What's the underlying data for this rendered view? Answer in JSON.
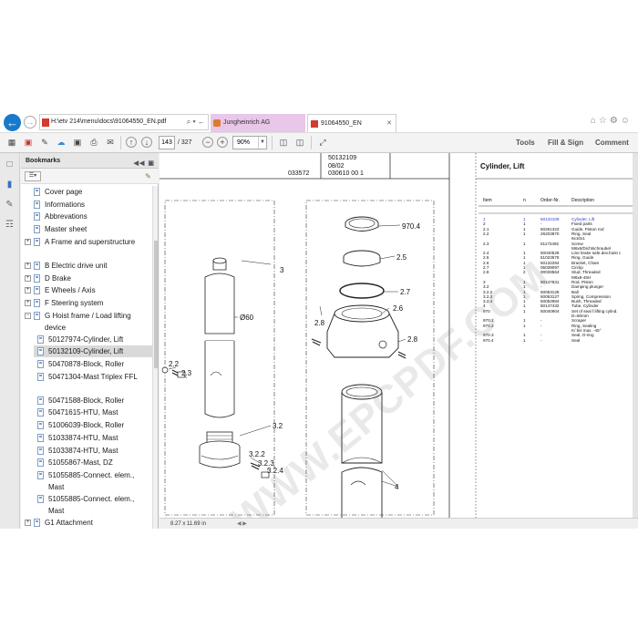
{
  "browser": {
    "url": "H:\\etv 214\\menu\\docs\\91064550_EN.pdf",
    "url_icons": "⌕ ▾ ←",
    "tabs": [
      {
        "label": "Jungheinrich AG"
      },
      {
        "label": "91064550_EN"
      }
    ]
  },
  "toolbar": {
    "current_page": "143",
    "page_total": "/ 327",
    "zoom": "90%",
    "links": {
      "tools": "Tools",
      "fill_sign": "Fill & Sign",
      "comment": "Comment"
    }
  },
  "bookmarks": {
    "title": "Bookmarks",
    "items": [
      {
        "label": "Cover page",
        "level": 1,
        "expandable": false
      },
      {
        "label": "Informations",
        "level": 1,
        "expandable": false
      },
      {
        "label": "Abbrevations",
        "level": 1,
        "expandable": false
      },
      {
        "label": "Master sheet",
        "level": 1,
        "expandable": false
      },
      {
        "label": "A Frame and superstructure",
        "level": 1,
        "expandable": true,
        "expanded": false
      },
      {
        "label": "B Electric drive unit",
        "level": 1,
        "expandable": true,
        "expanded": false
      },
      {
        "label": "D Brake",
        "level": 1,
        "expandable": true,
        "expanded": false
      },
      {
        "label": "E Wheels / Axis",
        "level": 1,
        "expandable": true,
        "expanded": false
      },
      {
        "label": "F Steering system",
        "level": 1,
        "expandable": true,
        "expanded": false
      },
      {
        "label": "G Hoist frame / Load lifting device",
        "level": 1,
        "expandable": true,
        "expanded": true
      },
      {
        "label": "50127974-Cylinder, Lift",
        "level": 2
      },
      {
        "label": "50132109-Cylinder, Lift",
        "level": 2,
        "selected": true
      },
      {
        "label": "50470878-Block, Roller",
        "level": 2
      },
      {
        "label": "50471304-Mast Triplex FFL",
        "level": 2
      },
      {
        "label": "50471588-Block, Roller",
        "level": 2
      },
      {
        "label": "50471615-HTU, Mast",
        "level": 2
      },
      {
        "label": "51006039-Block, Roller",
        "level": 2
      },
      {
        "label": "51033874-HTU, Mast",
        "level": 2
      },
      {
        "label": "51033874-HTU, Mast",
        "level": 2
      },
      {
        "label": "51055867-Mast, DZ",
        "level": 2
      },
      {
        "label": "51055885-Connect. elem., Mast",
        "level": 2
      },
      {
        "label": "51055885-Connect. elem., Mast",
        "level": 2
      },
      {
        "label": "G1 Attachment",
        "level": 1,
        "expandable": true,
        "expanded": false
      },
      {
        "label": "H Connection Chassis / Load",
        "level": 1,
        "expandable": true,
        "expanded": false
      }
    ]
  },
  "document": {
    "header": {
      "part_no": "50132109",
      "date": "08/02",
      "left_code": "033572",
      "right_code": "030610 00 1",
      "section_title": "Cylinder, Lift"
    },
    "callouts": [
      "970.4",
      "2.5",
      "2.7",
      "2.6",
      "2.8",
      "2.8",
      "3",
      "Ø60",
      "2.2",
      "2.3",
      "3.2",
      "3.2.2",
      "3.2.3",
      "3.2.4",
      "4"
    ],
    "parts_headers": {
      "item": "Item",
      "qty": "n",
      "order_no": "Order-Nr.",
      "description": "Description"
    },
    "parts": [
      {
        "item": "1",
        "qty": "1",
        "order": "50132109",
        "desc": "Cylinder, Lift",
        "hl": true
      },
      {
        "item": "2",
        "qty": "1",
        "order": "-",
        "desc": "Fixed parts"
      },
      {
        "item": "2.1",
        "qty": "1",
        "order": "50261323",
        "desc": "Guide, Piston rod"
      },
      {
        "item": "2.2",
        "qty": "1",
        "order": "26203870",
        "desc": "Ring, Seal"
      },
      {
        "item": "",
        "qty": "",
        "order": "",
        "desc": "6x10x1"
      },
      {
        "item": "2.3",
        "qty": "1",
        "order": "51172492",
        "desc": "Screw"
      },
      {
        "item": "",
        "qty": "",
        "order": "",
        "desc": "M6x6/Dichtschraubel"
      },
      {
        "item": "2.4",
        "qty": "1",
        "order": "50040528",
        "desc": "Line brake safe.dev.hoist c"
      },
      {
        "item": "2.5",
        "qty": "1",
        "order": "51023678",
        "desc": "Ring, Guide"
      },
      {
        "item": "2.6",
        "qty": "1",
        "order": "50132284",
        "desc": "Bracket, Chain"
      },
      {
        "item": "2.7",
        "qty": "1",
        "order": "05039097",
        "desc": "Circlip"
      },
      {
        "item": "2.8",
        "qty": "2",
        "order": "00028564",
        "desc": "Stud, Threaded"
      },
      {
        "item": "",
        "qty": "",
        "order": "",
        "desc": "M6x8-45H"
      },
      {
        "item": "3",
        "qty": "1",
        "order": "50147831",
        "desc": "Rod, Piston"
      },
      {
        "item": "3.2",
        "qty": "1",
        "order": "-",
        "desc": "Damping plunger"
      },
      {
        "item": "3.2.2",
        "qty": "1",
        "order": "50053128",
        "desc": "Ball"
      },
      {
        "item": "3.2.3",
        "qty": "1",
        "order": "50053127",
        "desc": "Spring, Compression"
      },
      {
        "item": "3.2.4",
        "qty": "1",
        "order": "50052984",
        "desc": "Bush, Threaded"
      },
      {
        "item": "4",
        "qty": "1",
        "order": "50147432",
        "desc": "Tube, Cylinder"
      },
      {
        "item": "970",
        "qty": "1",
        "order": "50040904",
        "desc": "Set of seal f.lifting cylind."
      },
      {
        "item": "",
        "qty": "",
        "order": "",
        "desc": "D=60mm"
      },
      {
        "item": "970.1",
        "qty": "1",
        "order": "-",
        "desc": "Scraper"
      },
      {
        "item": "970.2",
        "qty": "1",
        "order": "-",
        "desc": "Ring, Sealing"
      },
      {
        "item": "",
        "qty": "",
        "order": "",
        "desc": "K/ bis max. -45°"
      },
      {
        "item": "970.3",
        "qty": "1",
        "order": "-",
        "desc": "Seal, O-ring"
      },
      {
        "item": "970.4",
        "qty": "1",
        "order": "-",
        "desc": "Seal"
      }
    ],
    "page_size": "8.27 x 11.69 in"
  },
  "watermark": "WWW.EPCPDF.COM",
  "colors": {
    "accent_blue": "#1979ca",
    "tab_pink": "#e8c7e8",
    "highlight_text": "#2a3fd0"
  },
  "icons": {
    "back": "arrow-left-icon",
    "forward": "arrow-right-icon",
    "bookmark": "bookmark-icon",
    "pages": "pages-icon"
  }
}
